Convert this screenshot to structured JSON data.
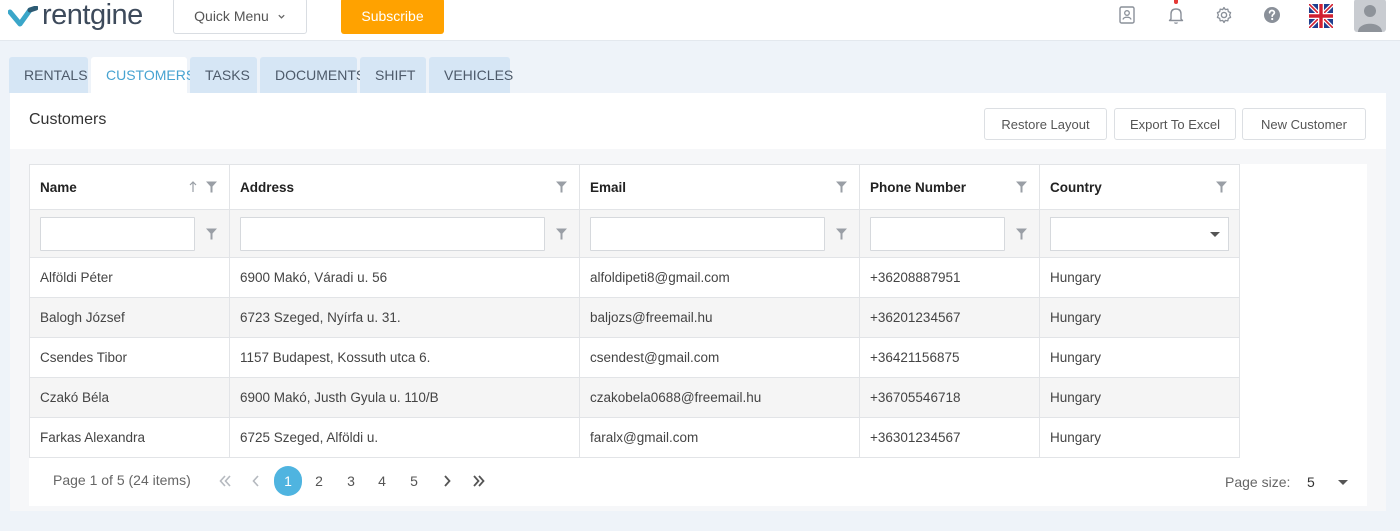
{
  "header": {
    "logo_text": "rentgine",
    "quick_menu_label": "Quick Menu",
    "subscribe_label": "Subscribe",
    "accent_color": "#ffa200"
  },
  "tabs": [
    {
      "label": "RENTALS",
      "active": false
    },
    {
      "label": "CUSTOMERS",
      "active": true
    },
    {
      "label": "TASKS",
      "active": false
    },
    {
      "label": "DOCUMENTS",
      "active": false
    },
    {
      "label": "SHIFT",
      "active": false
    },
    {
      "label": "VEHICLES",
      "active": false
    }
  ],
  "panel": {
    "title": "Customers",
    "restore_layout_label": "Restore Layout",
    "export_label": "Export To Excel",
    "new_customer_label": "New Customer"
  },
  "grid": {
    "columns": [
      "Name",
      "Address",
      "Email",
      "Phone Number",
      "Country"
    ],
    "rows": [
      [
        "Alföldi Péter",
        "6900 Makó, Váradi u. 56",
        "alfoldipeti8@gmail.com",
        "+36208887951",
        "Hungary"
      ],
      [
        "Balogh József",
        "6723 Szeged, Nyírfa u. 31.",
        "baljozs@freemail.hu",
        "+36201234567",
        "Hungary"
      ],
      [
        "Csendes Tibor",
        "1157 Budapest, Kossuth utca 6.",
        "csendest@gmail.com",
        "+36421156875",
        "Hungary"
      ],
      [
        "Czakó Béla",
        "6900 Makó, Justh Gyula u. 110/B",
        "czakobela0688@freemail.hu",
        "+36705546718",
        "Hungary"
      ],
      [
        "Farkas Alexandra",
        "6725 Szeged, Alföldi u.",
        "faralx@gmail.com",
        "+36301234567",
        "Hungary"
      ]
    ]
  },
  "pager": {
    "info": "Page 1 of 5 (24 items)",
    "pages": [
      "1",
      "2",
      "3",
      "4",
      "5"
    ],
    "current_page": "1",
    "page_size_label": "Page size:",
    "page_size_value": "5"
  }
}
